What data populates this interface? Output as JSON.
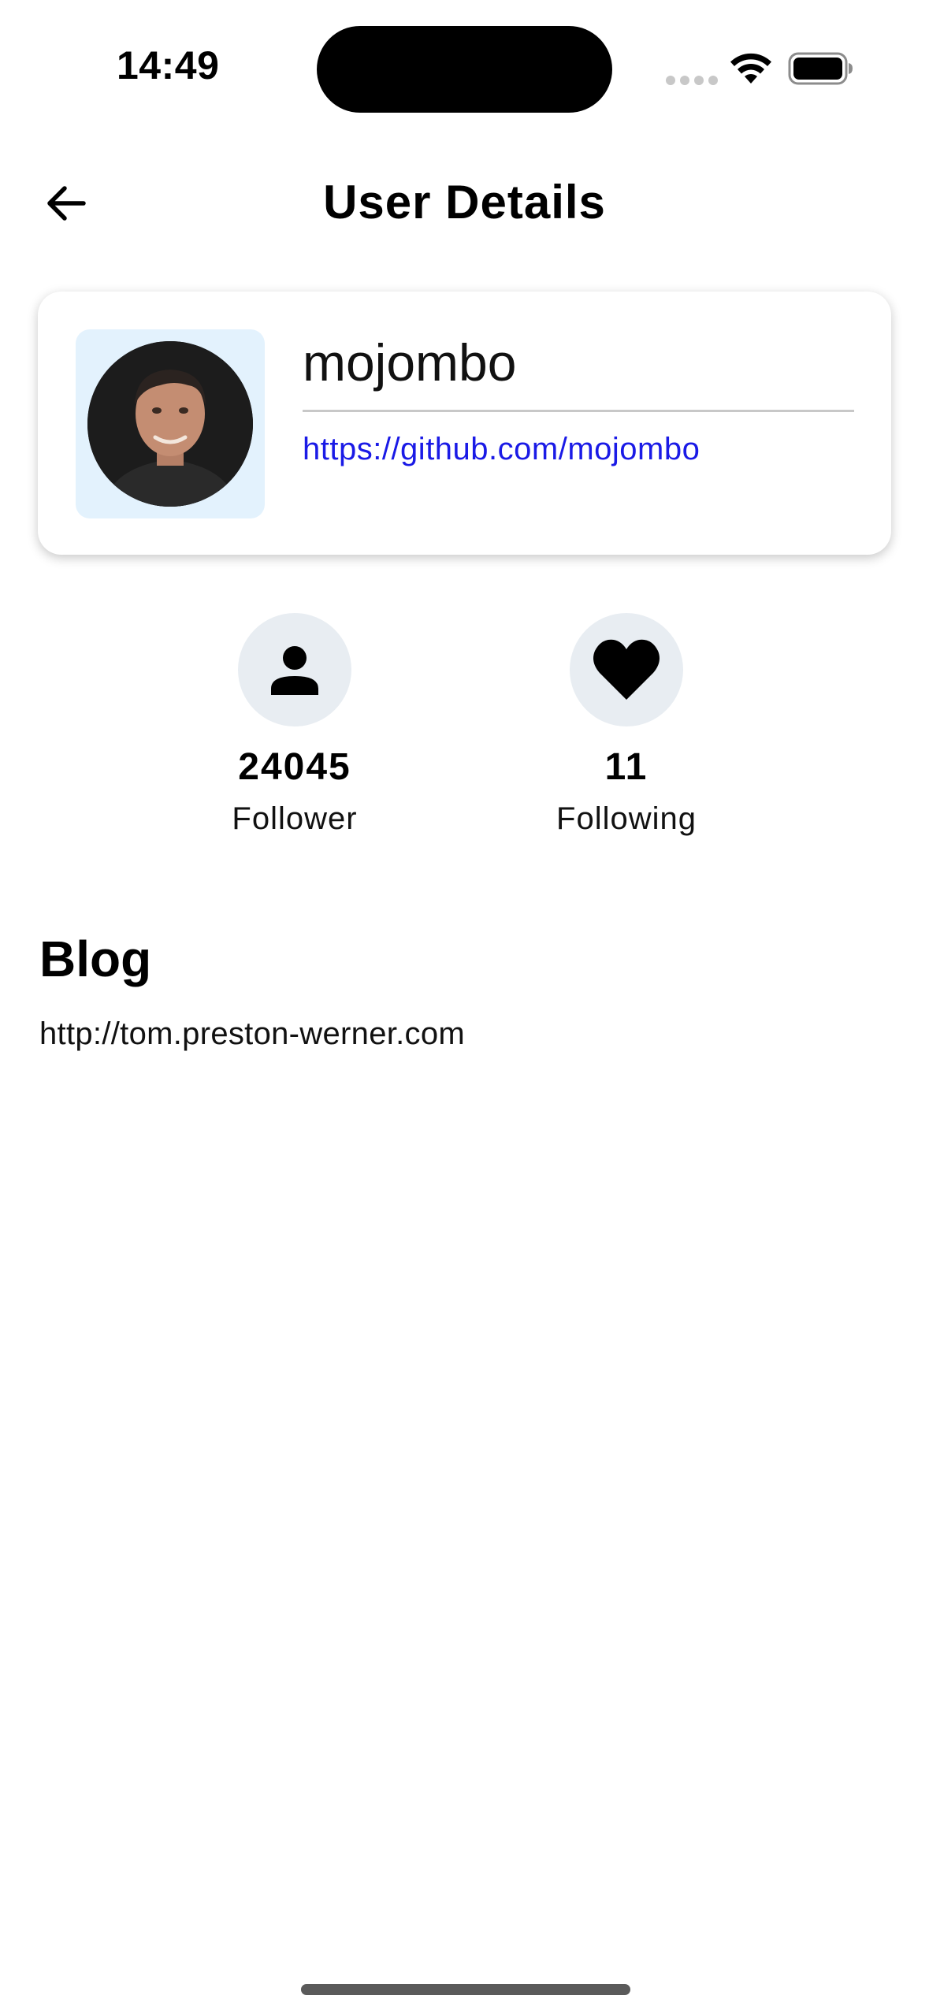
{
  "status_bar": {
    "time": "14:49"
  },
  "app_bar": {
    "title": "User Details",
    "back_icon": "arrow-left-icon"
  },
  "profile": {
    "username": "mojombo",
    "profile_url": "https://github.com/mojombo",
    "avatar_bg": "#e3f2fd",
    "link_color": "#1a1ae6"
  },
  "stats": {
    "follower": {
      "icon": "person-icon",
      "count": "24045",
      "label": "Follower"
    },
    "following": {
      "icon": "heart-icon",
      "count": "11",
      "label": "Following"
    }
  },
  "blog": {
    "heading": "Blog",
    "url": "http://tom.preston-werner.com"
  }
}
